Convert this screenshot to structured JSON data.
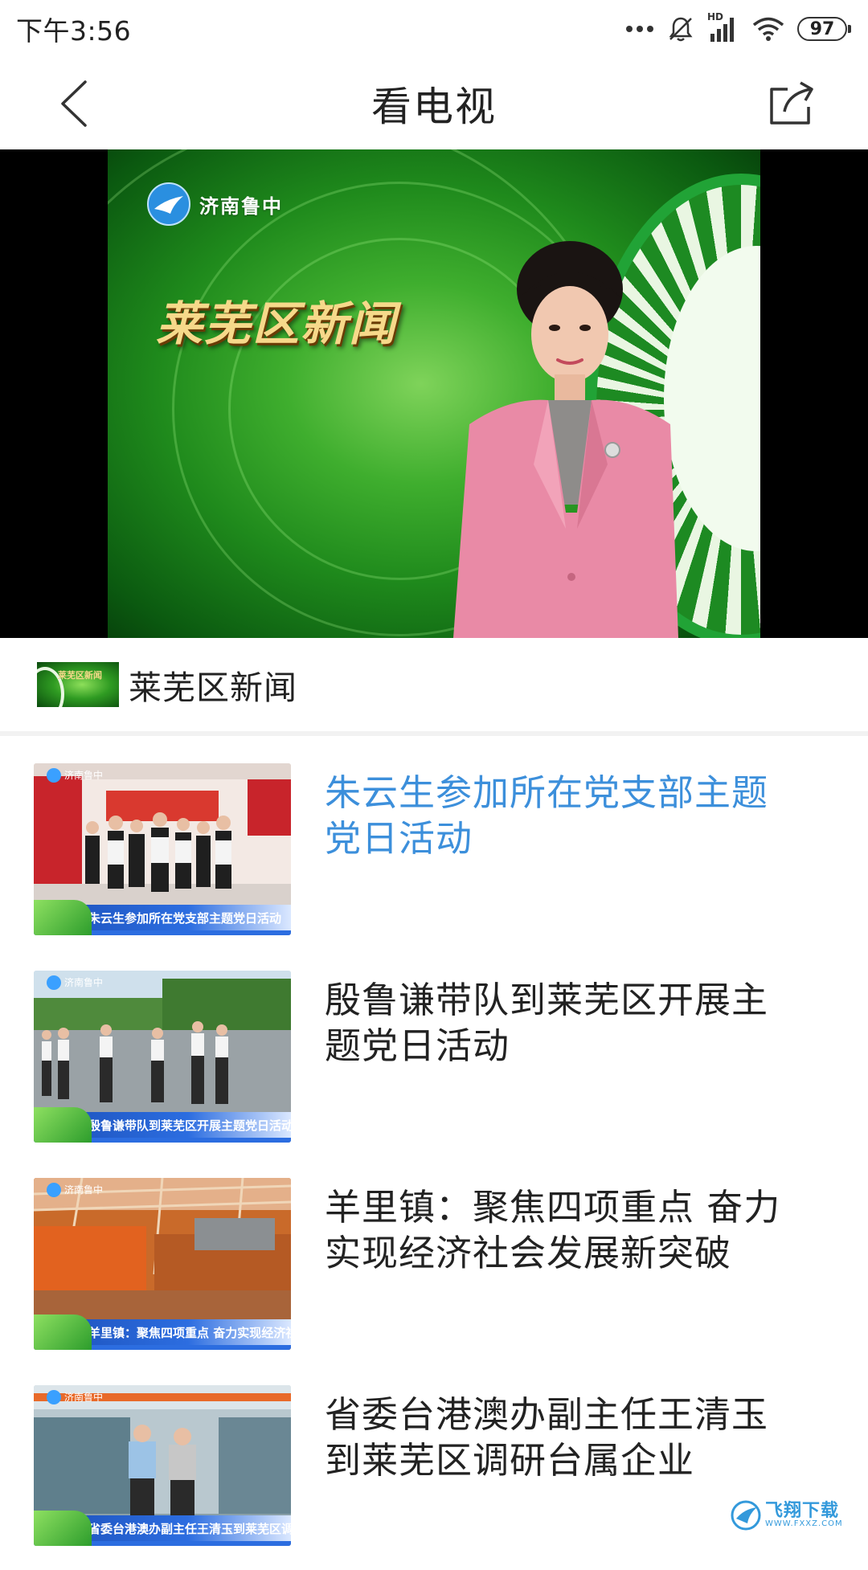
{
  "status_bar": {
    "time": "下午3:56",
    "network_badge": "HD",
    "battery": "97",
    "icons": [
      "more-dots-icon",
      "mute-bell-icon",
      "signal-icon",
      "wifi-icon",
      "battery-icon"
    ]
  },
  "nav": {
    "title": "看电视",
    "back_icon": "chevron-left-icon",
    "share_icon": "share-icon"
  },
  "player": {
    "channel_logo_text": "济南鲁中",
    "show_title": "莱芜区新闻"
  },
  "program": {
    "name": "莱芜区新闻"
  },
  "news": [
    {
      "title": "朱云生参加所在党支部主题党日活动",
      "caption": "朱云生参加所在党支部主题党日活动",
      "active": true
    },
    {
      "title": "殷鲁谦带队到莱芜区开展主题党日活动",
      "caption": "殷鲁谦带队到莱芜区开展主题党日活动",
      "active": false
    },
    {
      "title": "羊里镇：聚焦四项重点 奋力实现经济社会发展新突破",
      "caption": "羊里镇：聚焦四项重点 奋力实现经济社会发展新突破",
      "active": false
    },
    {
      "title": "省委台港澳办副主任王清玉到莱芜区调研台属企业",
      "caption": "省委台港澳办副主任王清玉到莱芜区调研台属企业",
      "active": false
    }
  ],
  "colors": {
    "active_title": "#3c8fdb",
    "default_title": "#222222",
    "divider": "#f2f2f2"
  },
  "watermark": {
    "main": "飞翔下载",
    "sub": "WWW.FXXZ.COM"
  }
}
